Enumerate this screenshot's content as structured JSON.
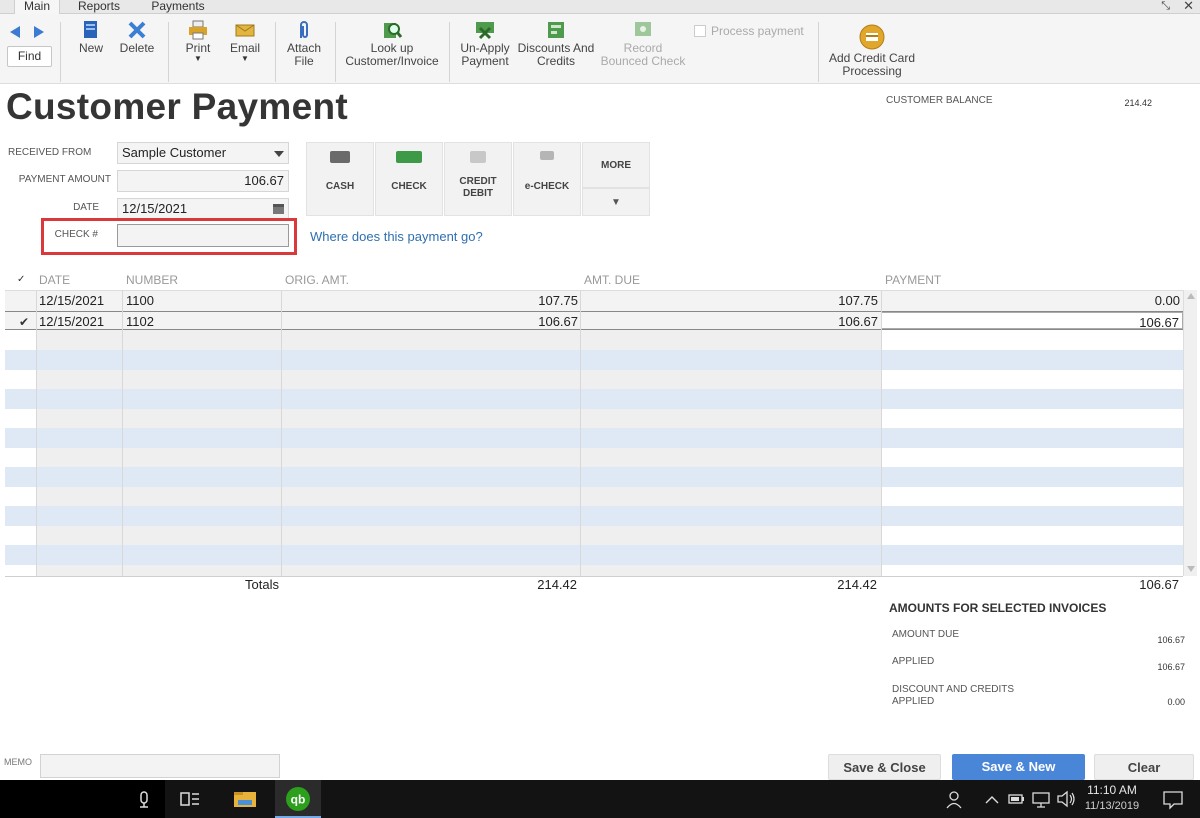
{
  "tabs": {
    "main": "Main",
    "reports": "Reports",
    "payments": "Payments"
  },
  "window": {
    "restore": "⤡",
    "close": "✕"
  },
  "toolbar": {
    "find": "Find",
    "new": "New",
    "delete": "Delete",
    "print": "Print",
    "email": "Email",
    "attach_line1": "Attach",
    "attach_line2": "File",
    "lookup_line1": "Look up",
    "lookup_line2": "Customer/Invoice",
    "unapply_line1": "Un-Apply",
    "unapply_line2": "Payment",
    "discounts_line1": "Discounts And",
    "discounts_line2": "Credits",
    "record_line1": "Record",
    "record_line2": "Bounced Check",
    "process_payment": "Process payment",
    "addcc_line1": "Add Credit Card",
    "addcc_line2": "Processing"
  },
  "page": {
    "title": "Customer Payment"
  },
  "customer_balance": {
    "label": "CUSTOMER BALANCE",
    "value": "214.42"
  },
  "form": {
    "received_from_label": "RECEIVED FROM",
    "received_from_value": "Sample Customer",
    "payment_amount_label": "PAYMENT AMOUNT",
    "payment_amount_value": "106.67",
    "date_label": "DATE",
    "date_value": "12/15/2021",
    "check_label": "CHECK #",
    "check_value": "",
    "where_link": "Where does this payment go?"
  },
  "payment_methods": {
    "cash": "CASH",
    "check": "CHECK",
    "credit_line1": "CREDIT",
    "credit_line2": "DEBIT",
    "echeck": "e-CHECK",
    "more": "MORE",
    "more_arrow": "▼"
  },
  "table": {
    "check_header": "✓",
    "headers": {
      "date": "DATE",
      "number": "NUMBER",
      "orig_amt": "ORIG. AMT.",
      "amt_due": "AMT. DUE",
      "payment": "PAYMENT"
    },
    "rows": [
      {
        "checked": "",
        "date": "12/15/2021",
        "number": "1100",
        "orig_amt": "107.75",
        "amt_due": "107.75",
        "payment": "0.00"
      },
      {
        "checked": "✔",
        "date": "12/15/2021",
        "number": "1102",
        "orig_amt": "106.67",
        "amt_due": "106.67",
        "payment": "106.67"
      }
    ],
    "totals": {
      "label": "Totals",
      "orig_amt": "214.42",
      "amt_due": "214.42",
      "payment": "106.67"
    }
  },
  "summary": {
    "title": "AMOUNTS FOR SELECTED INVOICES",
    "amount_due_label": "AMOUNT DUE",
    "amount_due_value": "106.67",
    "applied_label": "APPLIED",
    "applied_value": "106.67",
    "discount_line1": "DISCOUNT AND CREDITS",
    "discount_line2": "APPLIED",
    "discount_value": "0.00"
  },
  "footer": {
    "memo_label": "MEMO",
    "memo_value": "",
    "save_close": "Save & Close",
    "save_new": "Save & New",
    "clear": "Clear"
  },
  "taskbar": {
    "time": "11:10 AM",
    "date": "11/13/2019",
    "qb_label": "qb"
  },
  "colors": {
    "accent_blue": "#4a86d8",
    "highlight_red": "#d9393b",
    "link_blue": "#2f6fb0",
    "stripe_blue": "#dfe9f6",
    "qb_green": "#2ca01c"
  },
  "icons": {
    "back": "arrow-left-icon",
    "forward": "arrow-right-icon",
    "new": "new-document-icon",
    "delete": "delete-x-icon",
    "print": "printer-icon",
    "email": "envelope-icon",
    "attach": "paperclip-icon",
    "lookup": "lookup-icon",
    "unapply": "unapply-icon",
    "discounts": "discounts-icon",
    "record": "bounced-check-icon",
    "addcc": "credit-card-coin-icon"
  }
}
